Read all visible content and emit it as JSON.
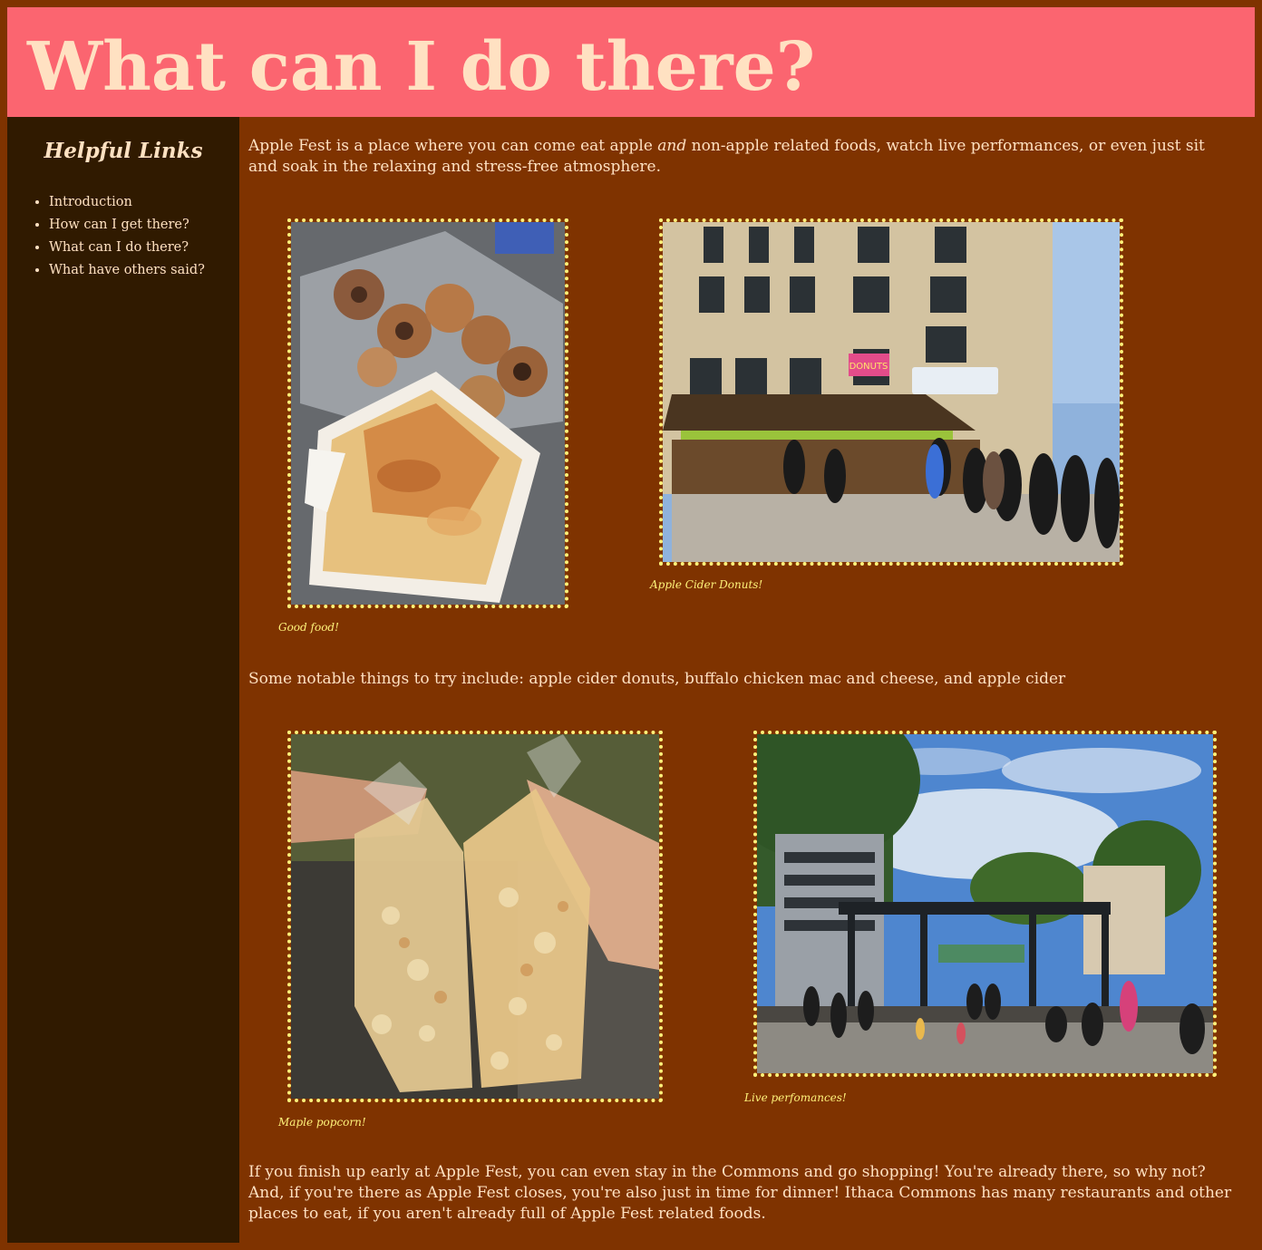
{
  "header": {
    "title": "What can I do there?"
  },
  "sidebar": {
    "heading": "Helpful Links",
    "links": [
      {
        "label": "Introduction"
      },
      {
        "label": "How can I get there?"
      },
      {
        "label": "What can I do there?"
      },
      {
        "label": "What have others said?"
      }
    ]
  },
  "main": {
    "intro_before": "Apple Fest is a place where you can come eat apple ",
    "intro_emphasis": "and",
    "intro_after": " non-apple related foods, watch live performances, or even just sit and soak in the relaxing and stress-free atmosphere.",
    "notable": "Some notable things to try include: apple cider donuts, buffalo chicken mac and cheese, and apple cider",
    "closing": "If you finish up early at Apple Fest, you can even stay in the Commons and go shopping! You're already there, so why not? And, if you're there as Apple Fest closes, you're also just in time for dinner! Ithaca Commons has many restaurants and other places to eat, if you aren't already full of Apple Fest related foods.",
    "photos": [
      {
        "caption": "Good food!",
        "sign_text": ""
      },
      {
        "caption": "Apple Cider Donuts!",
        "sign_text": "DONUTS"
      },
      {
        "caption": "Maple popcorn!",
        "sign_text": ""
      },
      {
        "caption": "Live perfomances!",
        "sign_text": ""
      }
    ]
  },
  "colors": {
    "page_background": "#7f3300",
    "header_background": "#fb6570",
    "sidebar_background": "#301a00",
    "text": "#ffe1c2",
    "photo_border": "#fff27a",
    "caption": "#fff27a"
  }
}
